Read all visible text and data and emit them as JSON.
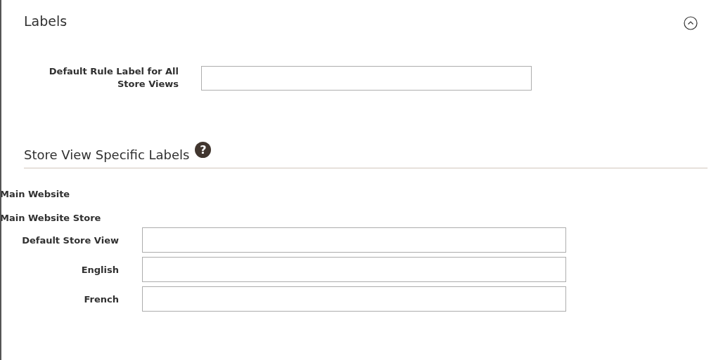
{
  "section": {
    "title": "Labels",
    "expanded": true
  },
  "default_label": {
    "label": "Default Rule Label for All Store Views"
  },
  "store_labels": {
    "title": "Store View Specific Labels",
    "help": "?",
    "website": "Main Website",
    "store": "Main Website Store",
    "views": [
      {
        "label": "Default Store View"
      },
      {
        "label": "English"
      },
      {
        "label": "French"
      }
    ]
  }
}
